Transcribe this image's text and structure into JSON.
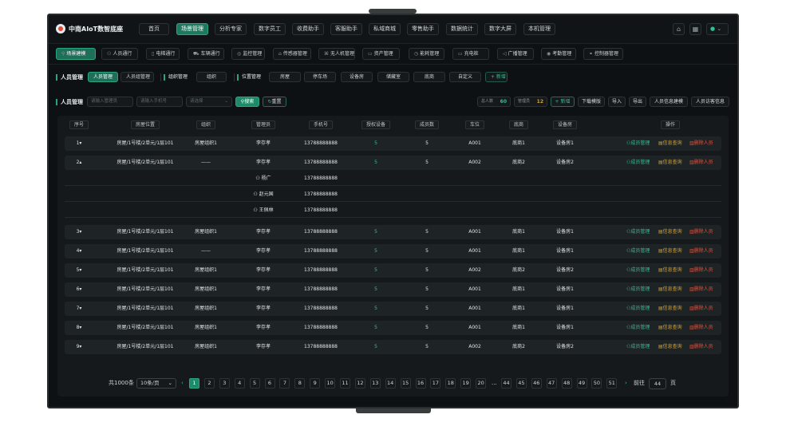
{
  "app": {
    "title": "中南AIoT数智底座"
  },
  "topnav": {
    "items": [
      "首页",
      "场景管理",
      "分析专家",
      "数字员工",
      "收费助手",
      "客服助手",
      "私域商城",
      "零售助手",
      "数据统计",
      "数字大屏",
      "本机管理"
    ],
    "active_index": 1,
    "user_caret": "⌄"
  },
  "subnav": {
    "items": [
      "场景建模",
      "人员通行",
      "电梯通行",
      "车辆通行",
      "监控管理",
      "传感器管理",
      "无人机管理",
      "资产管理",
      "能耗管理",
      "充电桩",
      "广播管理",
      "考勤管理",
      "控制器管理"
    ],
    "icons": [
      "⚲",
      "⚇",
      "▯",
      "⛟",
      "◎",
      "⌂",
      "⌘",
      "▭",
      "◷",
      "▭",
      "◁",
      "◉",
      "⚭"
    ],
    "active_index": 0
  },
  "filter": {
    "personnel_label": "人员管理",
    "personnel_tabs": [
      "人员管理",
      "人员组管理"
    ],
    "org_label": "组织管理",
    "org_chip": "组织",
    "location_label": "位置管理",
    "location_chips": [
      "房屋",
      "停车场",
      "设备房",
      "储藏室",
      "底商",
      "自定义"
    ],
    "add_label": "+ 新增"
  },
  "search": {
    "section_label": "人员管理",
    "name_placeholder": "请输入管理员",
    "phone_placeholder": "请输入手机号",
    "select_placeholder": "请选择",
    "search_button": "搜索",
    "reset_button": "重置",
    "total_label": "总人数",
    "total_value": "60",
    "admin_label": "管理员",
    "admin_value": "12",
    "buttons": [
      "+ 新增",
      "下载模版",
      "导入",
      "导出",
      "人员信息建模",
      "人员访客信息"
    ]
  },
  "table": {
    "headers": [
      "序号",
      "房屋位置",
      "组织",
      "管理员",
      "手机号",
      "授权设备",
      "成员数",
      "车位",
      "底商",
      "设备房",
      "操作"
    ],
    "actions": [
      "成员管理",
      "信息查询",
      "删除人员"
    ],
    "rows": [
      {
        "idx": "1",
        "arrow": "▾",
        "loc": "房屋/1号楼/2单元/1层101",
        "org": "房屋组织1",
        "admin": "李存孝",
        "phone": "13788888888",
        "dev": "5",
        "members": "5",
        "slot": "A001",
        "shop": "底商1",
        "room": "设备房1"
      },
      {
        "idx": "2",
        "arrow": "▴",
        "loc": "房屋/1号楼/2单元/1层101",
        "org": "——",
        "admin": "李存孝",
        "phone": "13788888888",
        "dev": "5",
        "members": "5",
        "slot": "A002",
        "shop": "底商2",
        "room": "设备房2"
      },
      {
        "idx": "3",
        "arrow": "▾",
        "loc": "房屋/1号楼/2单元/1层101",
        "org": "房屋组织1",
        "admin": "李存孝",
        "phone": "13788888888",
        "dev": "5",
        "members": "5",
        "slot": "A001",
        "shop": "底商1",
        "room": "设备房1"
      },
      {
        "idx": "4",
        "arrow": "▾",
        "loc": "房屋/1号楼/2单元/1层101",
        "org": "——",
        "admin": "李存孝",
        "phone": "13788888888",
        "dev": "5",
        "members": "5",
        "slot": "A001",
        "shop": "底商1",
        "room": "设备房1"
      },
      {
        "idx": "5",
        "arrow": "▾",
        "loc": "房屋/1号楼/2单元/1层101",
        "org": "房屋组织1",
        "admin": "李存孝",
        "phone": "13788888888",
        "dev": "5",
        "members": "5",
        "slot": "A002",
        "shop": "底商2",
        "room": "设备房2"
      },
      {
        "idx": "6",
        "arrow": "▾",
        "loc": "房屋/1号楼/2单元/1层101",
        "org": "房屋组织1",
        "admin": "李存孝",
        "phone": "13788888888",
        "dev": "5",
        "members": "5",
        "slot": "A001",
        "shop": "底商1",
        "room": "设备房1"
      },
      {
        "idx": "7",
        "arrow": "▾",
        "loc": "房屋/1号楼/2单元/1层101",
        "org": "房屋组织1",
        "admin": "李存孝",
        "phone": "13788888888",
        "dev": "5",
        "members": "5",
        "slot": "A001",
        "shop": "底商1",
        "room": "设备房1"
      },
      {
        "idx": "8",
        "arrow": "▾",
        "loc": "房屋/1号楼/2单元/1层101",
        "org": "房屋组织1",
        "admin": "李存孝",
        "phone": "13788888888",
        "dev": "5",
        "members": "5",
        "slot": "A001",
        "shop": "底商1",
        "room": "设备房1"
      },
      {
        "idx": "9",
        "arrow": "▾",
        "loc": "房屋/1号楼/2单元/1层101",
        "org": "房屋组织1",
        "admin": "李存孝",
        "phone": "13788888888",
        "dev": "5",
        "members": "5",
        "slot": "A002",
        "shop": "底商2",
        "room": "设备房2"
      }
    ],
    "expanded_members": [
      {
        "name": "杨广",
        "phone": "13788888888"
      },
      {
        "name": "赵元国",
        "phone": "13788888888"
      },
      {
        "name": "王佩林",
        "phone": "13788888888"
      }
    ]
  },
  "pagination": {
    "total": "共1000条",
    "page_size": "10条/页",
    "prev": "‹",
    "next": "›",
    "pages": [
      "1",
      "2",
      "3",
      "4",
      "5",
      "6",
      "7",
      "8",
      "9",
      "10",
      "11",
      "12",
      "13",
      "14",
      "15",
      "16",
      "17",
      "18",
      "19",
      "20",
      "...",
      "44",
      "45",
      "46",
      "47",
      "48",
      "49",
      "50",
      "51"
    ],
    "active_page": "1",
    "goto_label": "前往",
    "goto_value": "44",
    "page_suffix": "页"
  },
  "colors": {
    "accent": "#1f8a68",
    "accent_text": "#2fc28f",
    "warn": "#d4a32b",
    "danger": "#e0533f",
    "bg": "#0e1113"
  }
}
